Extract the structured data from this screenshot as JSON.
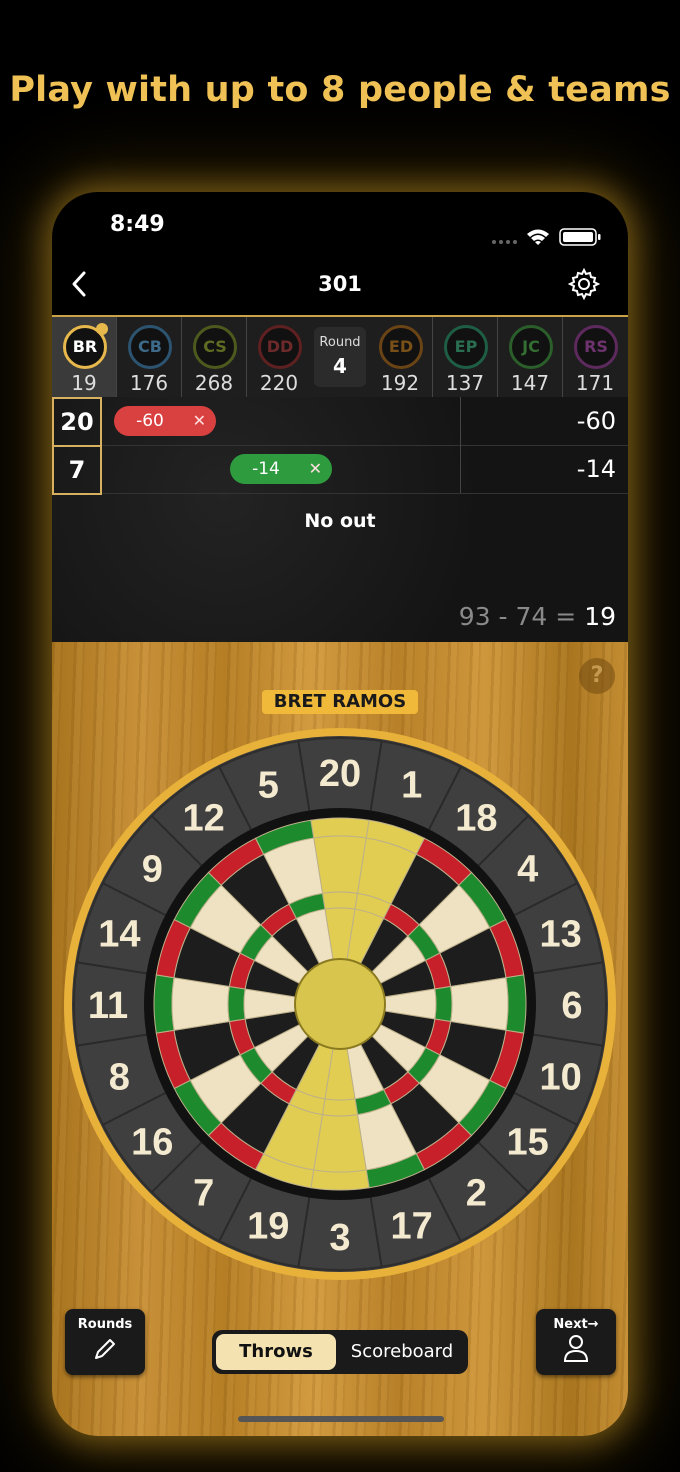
{
  "headline": "Play with up to 8 people & teams",
  "status": {
    "time": "8:49"
  },
  "nav": {
    "title": "301"
  },
  "round": {
    "label": "Round",
    "value": "4"
  },
  "players": [
    {
      "initials": "BR",
      "score": "19",
      "color": "#e7b84c",
      "active": true
    },
    {
      "initials": "CB",
      "score": "176",
      "color": "#3a6a8c"
    },
    {
      "initials": "CS",
      "score": "268",
      "color": "#6b7a2a"
    },
    {
      "initials": "DD",
      "score": "220",
      "color": "#7a2a2a"
    },
    {
      "initials": "ED",
      "score": "192",
      "color": "#8a5a1a"
    },
    {
      "initials": "EP",
      "score": "137",
      "color": "#2a7a5a"
    },
    {
      "initials": "JC",
      "score": "147",
      "color": "#3a7a3a"
    },
    {
      "initials": "RS",
      "score": "171",
      "color": "#7a3a7a"
    }
  ],
  "throws": [
    {
      "number": "20",
      "pill": "-60",
      "pill_color": "#d94141",
      "total": "-60"
    },
    {
      "number": "7",
      "pill": "-14",
      "pill_color": "#2e9b3e",
      "total": "-14"
    }
  ],
  "no_out": "No out",
  "calc": {
    "expr": "93 - 74 = ",
    "result": "19"
  },
  "help": "?",
  "current_player": "BRET RAMOS",
  "dart_numbers": [
    "20",
    "1",
    "18",
    "4",
    "13",
    "6",
    "10",
    "15",
    "2",
    "17",
    "3",
    "19",
    "7",
    "16",
    "8",
    "11",
    "14",
    "9",
    "12",
    "5"
  ],
  "buttons": {
    "rounds": "Rounds",
    "next": "Next→",
    "throws": "Throws",
    "scoreboard": "Scoreboard"
  },
  "colors": {
    "accent": "#f0c256",
    "single_light": "#efe2c2",
    "single_dark": "#1d1d1d",
    "red": "#c8202a",
    "green": "#1e8a2e",
    "highlight": "#e0cd52"
  }
}
